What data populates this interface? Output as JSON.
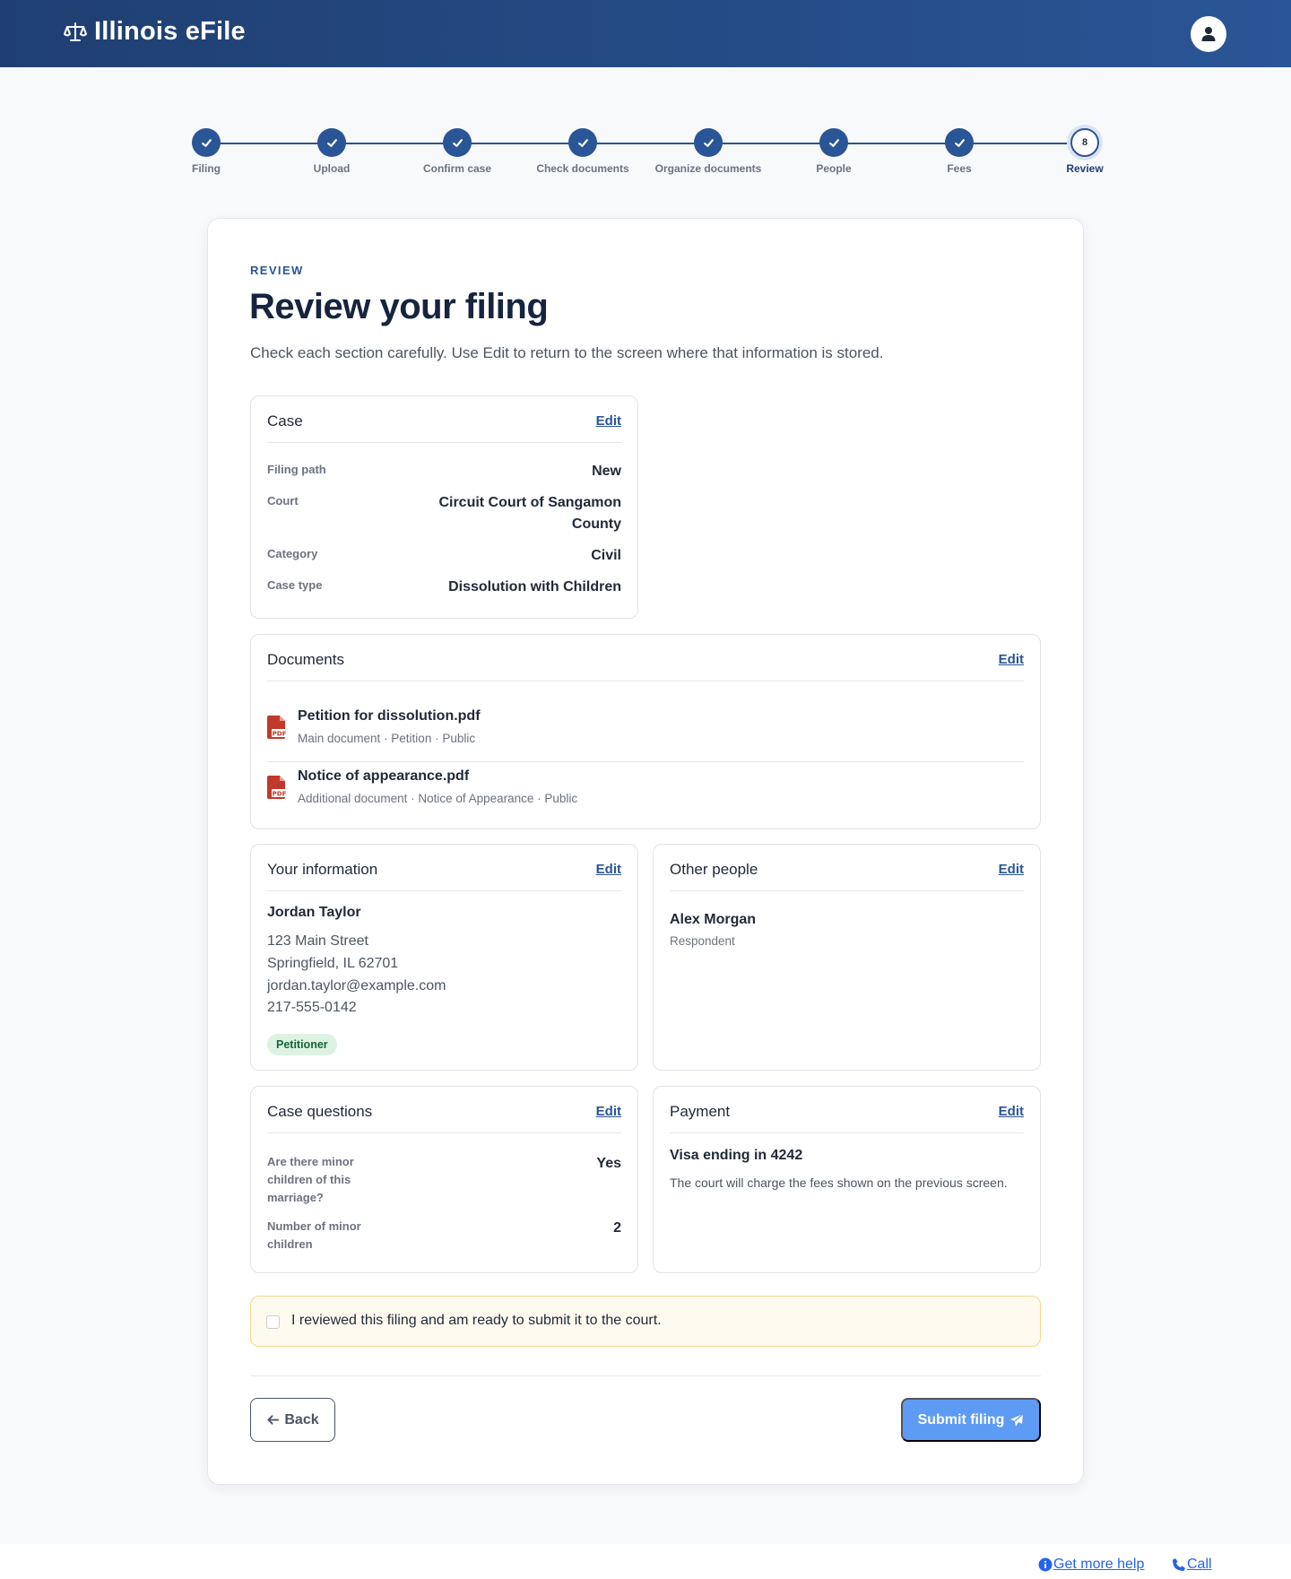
{
  "header": {
    "app_title": "Illinois eFile",
    "logo_icon": "scale-icon",
    "avatar_icon": "user-icon"
  },
  "stepper": {
    "steps": [
      {
        "label": "Filing",
        "state": "done"
      },
      {
        "label": "Upload",
        "state": "done"
      },
      {
        "label": "Confirm case",
        "state": "done"
      },
      {
        "label": "Check documents",
        "state": "done"
      },
      {
        "label": "Organize documents",
        "state": "done"
      },
      {
        "label": "People",
        "state": "done"
      },
      {
        "label": "Fees",
        "state": "done"
      },
      {
        "label": "Review",
        "state": "current",
        "number": "8"
      }
    ]
  },
  "page": {
    "eyebrow": "REVIEW",
    "title": "Review your filing",
    "lead": "Check each section carefully. Use Edit to return to the screen where that information is stored."
  },
  "case_panel": {
    "title": "Case",
    "edit": "Edit",
    "rows": [
      {
        "key": "Filing path",
        "value": "New"
      },
      {
        "key": "Court",
        "value_line1": "Circuit Court of Sangamon",
        "value_line2": "County"
      },
      {
        "key": "Category",
        "value": "Civil"
      },
      {
        "key": "Case type",
        "value": "Dissolution with Children"
      }
    ]
  },
  "documents_panel": {
    "title": "Documents",
    "edit": "Edit",
    "items": [
      {
        "name": "Petition for dissolution.pdf",
        "meta": "Main document · Petition · Public",
        "icon": "pdf-file-icon"
      },
      {
        "name": "Notice of appearance.pdf",
        "meta": "Additional document · Notice of Appearance · Public",
        "icon": "pdf-file-icon"
      }
    ]
  },
  "your_info_panel": {
    "title": "Your information",
    "edit": "Edit",
    "name": "Jordan Taylor",
    "address_line1": "123 Main Street",
    "address_line2": "Springfield, IL 62701",
    "email": "jordan.taylor@example.com",
    "phone": "217-555-0142",
    "role_badge": "Petitioner"
  },
  "other_people_panel": {
    "title": "Other people",
    "edit": "Edit",
    "name": "Alex Morgan",
    "role": "Respondent"
  },
  "case_questions_panel": {
    "title": "Case questions",
    "edit": "Edit",
    "rows": [
      {
        "key_lines": [
          "Are there minor",
          "children of this",
          "marriage?"
        ],
        "value": "Yes"
      },
      {
        "key_lines": [
          "Number of minor",
          "children"
        ],
        "value": "2"
      }
    ]
  },
  "payment_panel": {
    "title": "Payment",
    "edit": "Edit",
    "method": "Visa ending in 4242",
    "note": "The court will charge the fees shown on the previous screen."
  },
  "confirmation": {
    "checked": false,
    "label": "I reviewed this filing and am ready to submit it to the court."
  },
  "actions": {
    "back": "Back",
    "submit": "Submit filing",
    "back_icon": "arrow-left-icon",
    "submit_icon": "paper-plane-icon"
  },
  "footer": {
    "help": "Get more help",
    "call": "Call",
    "help_icon": "info-circle-icon",
    "call_icon": "phone-icon"
  },
  "colors": {
    "brand": "#2a5596",
    "brand_dark": "#1f3f72",
    "submit": "#5d9bf5",
    "badge_bg": "#dcf3e4",
    "badge_text": "#166534",
    "pdf": "#c0392b"
  }
}
